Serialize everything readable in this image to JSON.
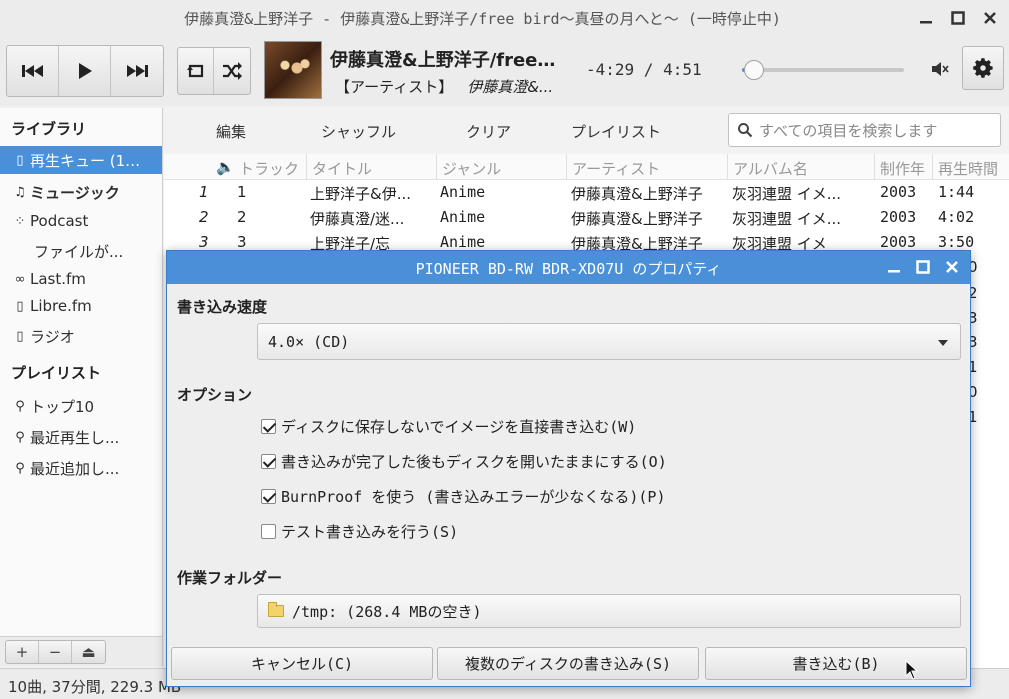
{
  "window": {
    "title": "伊藤真澄&上野洋子 - 伊藤真澄&上野洋子/free bird〜真昼の月へと〜 (一時停止中)"
  },
  "now_playing": {
    "title": "伊藤真澄&上野洋子/free…",
    "artist_label": "【アーティスト】",
    "artist": "伊藤真澄&...",
    "time": "-4:29 / 4:51",
    "progress": 0.076
  },
  "sidebar": {
    "library_heading": "ライブラリ",
    "items": [
      {
        "label": "再生キュー (1…",
        "icon": "queue-icon",
        "glyph": "▯"
      },
      {
        "label": "ミュージック",
        "icon": "music-note-icon",
        "glyph": "♫"
      },
      {
        "label": "Podcast",
        "icon": "rss-icon",
        "glyph": "⁘"
      },
      {
        "label": "ファイルが...",
        "icon": "",
        "glyph": ""
      },
      {
        "label": "Last.fm",
        "icon": "lastfm-icon",
        "glyph": "∞"
      },
      {
        "label": "Libre.fm",
        "icon": "librefm-icon",
        "glyph": "▯"
      },
      {
        "label": "ラジオ",
        "icon": "radio-icon",
        "glyph": "▯"
      }
    ],
    "playlist_heading": "プレイリスト",
    "playlists": [
      {
        "label": "トップ10",
        "icon": "search-icon"
      },
      {
        "label": "最近再生し...",
        "icon": "search-icon"
      },
      {
        "label": "最近追加し...",
        "icon": "search-icon"
      }
    ],
    "tools": [
      "+",
      "−",
      "⏏"
    ]
  },
  "actions": {
    "edit": "編集",
    "shuffle": "シャッフル",
    "clear": "クリア",
    "playlist": "プレイリスト"
  },
  "search": {
    "placeholder": "すべての項目を検索します"
  },
  "table": {
    "columns": [
      "トラック",
      "タイトル",
      "ジャンル",
      "アーティスト",
      "アルバム名",
      "制作年",
      "再生時間"
    ],
    "rows": [
      {
        "idx": "1",
        "track": "1",
        "title": "上野洋子&伊...",
        "genre": "Anime",
        "artist": "伊藤真澄&上野洋子",
        "album": "灰羽連盟 イメ...",
        "year": "2003",
        "duration": "1:44"
      },
      {
        "idx": "2",
        "track": "2",
        "title": "伊藤真澄/迷...",
        "genre": "Anime",
        "artist": "伊藤真澄&上野洋子",
        "album": "灰羽連盟 イメ...",
        "year": "2003",
        "duration": "4:02"
      },
      {
        "idx": "3",
        "track": "3",
        "title": "上野洋子/忘",
        "genre": "Anime",
        "artist": "伊藤真澄&上野洋子",
        "album": "灰羽連盟 イメ",
        "year": "2003",
        "duration": "3:50"
      }
    ],
    "peek_digits": [
      "0",
      "2",
      "3",
      "3",
      "1",
      "0",
      "1"
    ]
  },
  "status": {
    "text": "10曲, 37分間, 229.3 MB"
  },
  "dialog": {
    "title": "PIONEER BD-RW  BDR-XD07U のプロパティ",
    "speed_heading": "書き込み速度",
    "speed_value": "4.0× (CD)",
    "options_heading": "オプション",
    "options": [
      {
        "label": "ディスクに保存しないでイメージを直接書き込む(W)",
        "checked": true
      },
      {
        "label": "書き込みが完了した後もディスクを開いたままにする(O)",
        "checked": true
      },
      {
        "label": "BurnProof を使う (書き込みエラーが少なくなる)(P)",
        "checked": true
      },
      {
        "label": "テスト書き込みを行う(S)",
        "checked": false
      }
    ],
    "folder_heading": "作業フォルダー",
    "folder_value": "/tmp: (268.4 MBの空き)",
    "cancel": "キャンセル(C)",
    "multi": "複数のディスクの書き込み(S)",
    "burn": "書き込む(B)"
  },
  "colors": {
    "accent": "#4a90d9"
  }
}
